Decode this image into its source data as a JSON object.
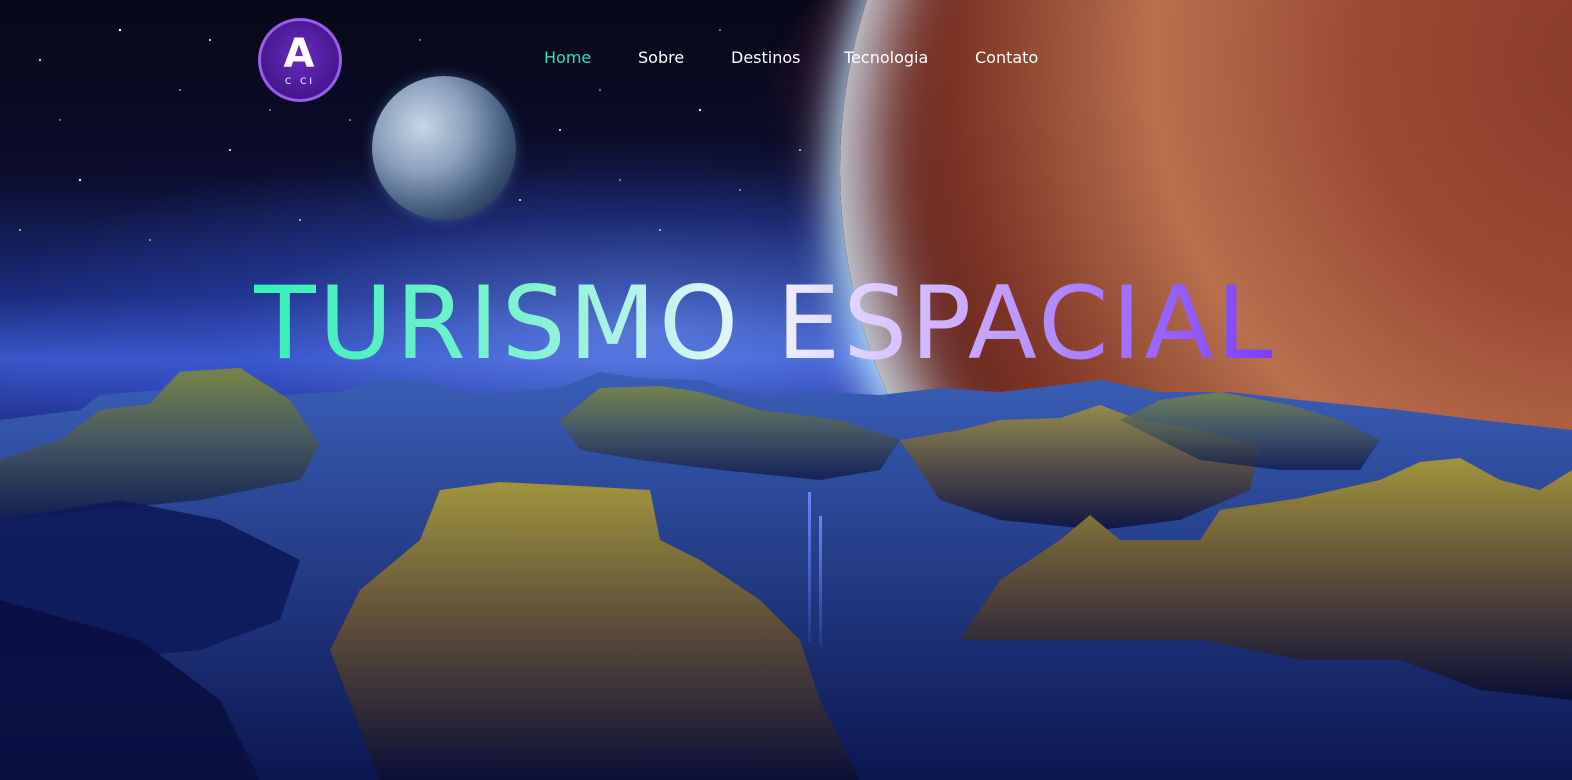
{
  "logo": {
    "letter": "A",
    "subtitle": "C CI"
  },
  "nav": {
    "items": [
      {
        "label": "Home",
        "active": true
      },
      {
        "label": "Sobre",
        "active": false
      },
      {
        "label": "Destinos",
        "active": false
      },
      {
        "label": "Tecnologia",
        "active": false
      },
      {
        "label": "Contato",
        "active": false
      }
    ]
  },
  "hero": {
    "title": "TURISMO ESPACIAL"
  },
  "colors": {
    "accent": "#2fe3b0",
    "gradient_start": "#36f0b8",
    "gradient_end": "#7a3cff",
    "logo_bg": "#4a1a94"
  },
  "icons": {
    "logo": "astronaut-logo-icon"
  }
}
